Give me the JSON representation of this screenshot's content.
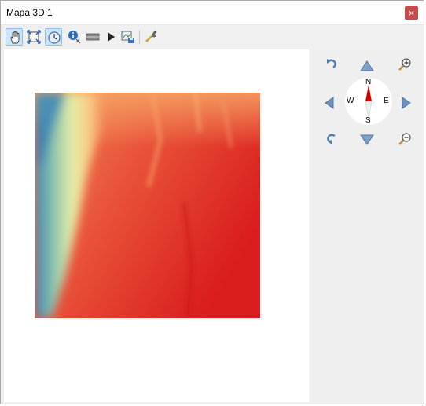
{
  "window": {
    "title": "Mapa 3D 1",
    "close_label": "×"
  },
  "toolbar": {
    "tools": [
      {
        "name": "pan-icon",
        "active": true
      },
      {
        "name": "zoom-full-icon",
        "active": false
      },
      {
        "name": "camera-control-icon",
        "active": true
      },
      {
        "name": "identify-icon",
        "active": false
      },
      {
        "name": "measure-icon",
        "active": false
      },
      {
        "name": "animation-play-icon",
        "active": false
      },
      {
        "name": "export-image-icon",
        "active": false
      },
      {
        "name": "configure-icon",
        "active": false
      }
    ]
  },
  "compass": {
    "n": "N",
    "s": "S",
    "e": "E",
    "w": "W"
  },
  "colors": {
    "accent_blue": "#5b88b8",
    "close_red": "#c64c4c",
    "needle_red": "#d40000"
  }
}
